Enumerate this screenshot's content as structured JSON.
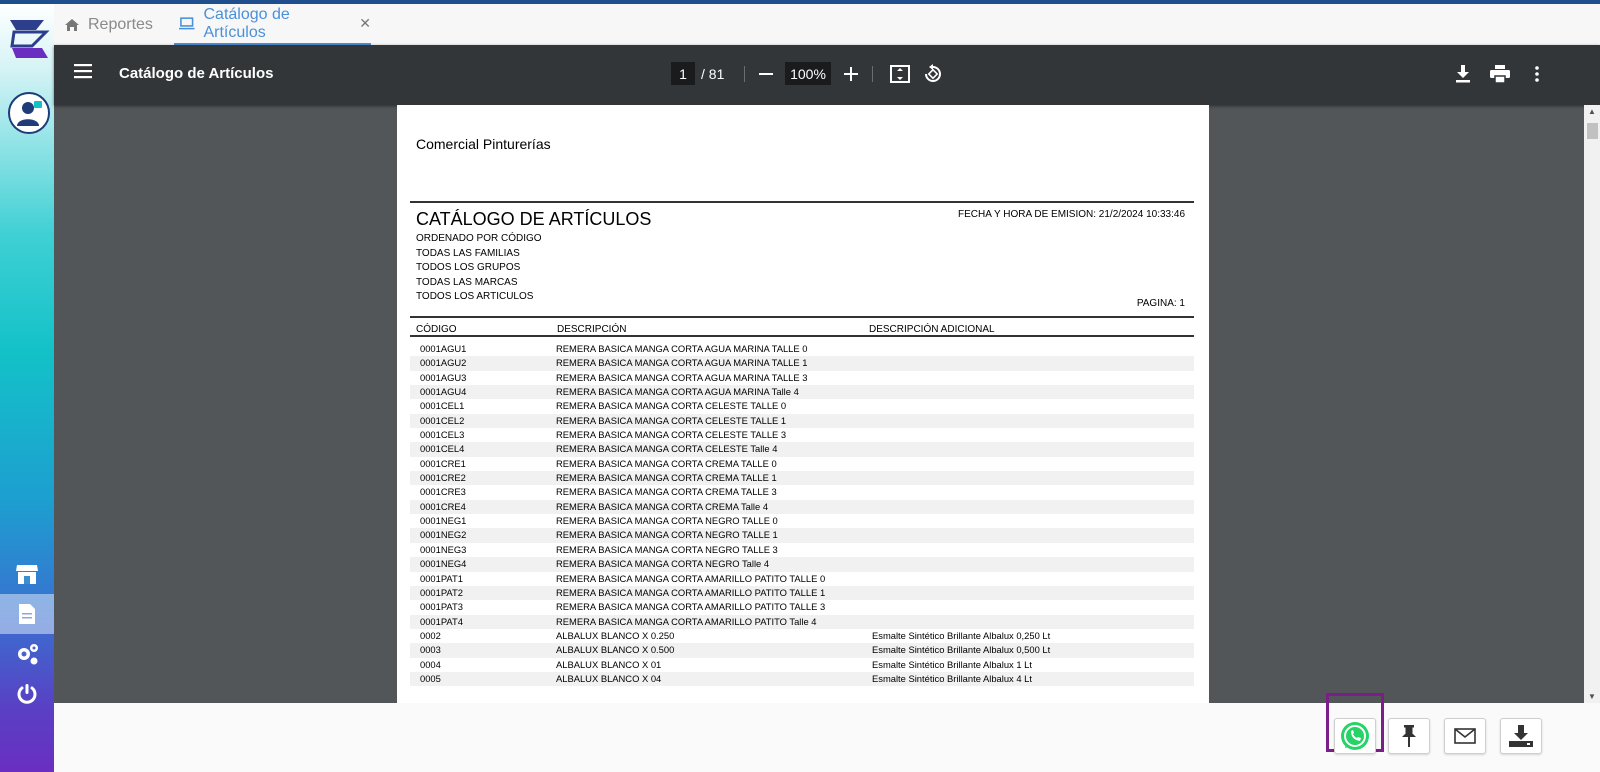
{
  "tabs": [
    {
      "label": "Reportes"
    },
    {
      "label": "Catálogo de Artículos"
    }
  ],
  "viewer": {
    "title": "Catálogo de Artículos",
    "current_page": "1",
    "page_total": "/ 81",
    "zoom": "100%"
  },
  "document": {
    "company": "Comercial Pinturerías",
    "title": "CATÁLOGO DE ARTÍCULOS",
    "emission": "FECHA Y HORA DE EMISION: 21/2/2024 10:33:46",
    "filters": [
      "ORDENADO POR CÓDIGO",
      "TODAS LAS FAMILIAS",
      "TODOS LOS GRUPOS",
      "TODAS LAS MARCAS",
      "TODOS LOS ARTICULOS"
    ],
    "pagina": "PAGINA: 1",
    "columns": {
      "code": "CÓDIGO",
      "desc": "DESCRIPCIÓN",
      "extra": "DESCRIPCIÓN ADICIONAL"
    },
    "rows": [
      [
        "0001AGU1",
        "REMERA BASICA MANGA CORTA AGUA MARINA TALLE 0",
        ""
      ],
      [
        "0001AGU2",
        "REMERA BASICA MANGA CORTA AGUA MARINA TALLE 1",
        ""
      ],
      [
        "0001AGU3",
        "REMERA BASICA MANGA CORTA AGUA MARINA TALLE 3",
        ""
      ],
      [
        "0001AGU4",
        "REMERA BASICA MANGA CORTA AGUA MARINA Talle 4",
        ""
      ],
      [
        "0001CEL1",
        "REMERA BASICA MANGA CORTA CELESTE TALLE 0",
        ""
      ],
      [
        "0001CEL2",
        "REMERA BASICA MANGA CORTA CELESTE TALLE 1",
        ""
      ],
      [
        "0001CEL3",
        "REMERA BASICA MANGA CORTA CELESTE TALLE 3",
        ""
      ],
      [
        "0001CEL4",
        "REMERA BASICA MANGA CORTA CELESTE Talle 4",
        ""
      ],
      [
        "0001CRE1",
        "REMERA BASICA MANGA CORTA CREMA TALLE 0",
        ""
      ],
      [
        "0001CRE2",
        "REMERA BASICA MANGA CORTA CREMA TALLE 1",
        ""
      ],
      [
        "0001CRE3",
        "REMERA BASICA MANGA CORTA CREMA TALLE 3",
        ""
      ],
      [
        "0001CRE4",
        "REMERA BASICA MANGA CORTA CREMA Talle 4",
        ""
      ],
      [
        "0001NEG1",
        "REMERA BASICA MANGA CORTA NEGRO TALLE 0",
        ""
      ],
      [
        "0001NEG2",
        "REMERA BASICA MANGA CORTA NEGRO TALLE 1",
        ""
      ],
      [
        "0001NEG3",
        "REMERA BASICA MANGA CORTA NEGRO TALLE 3",
        ""
      ],
      [
        "0001NEG4",
        "REMERA BASICA MANGA CORTA NEGRO Talle 4",
        ""
      ],
      [
        "0001PAT1",
        "REMERA BASICA MANGA CORTA AMARILLO PATITO TALLE 0",
        ""
      ],
      [
        "0001PAT2",
        "REMERA BASICA MANGA CORTA AMARILLO PATITO TALLE 1",
        ""
      ],
      [
        "0001PAT3",
        "REMERA BASICA MANGA CORTA AMARILLO PATITO TALLE 3",
        ""
      ],
      [
        "0001PAT4",
        "REMERA BASICA MANGA CORTA AMARILLO PATITO Talle 4",
        ""
      ],
      [
        "0002",
        "ALBALUX BLANCO X 0.250",
        "Esmalte Sintético Brillante Albalux 0,250 Lt"
      ],
      [
        "0003",
        "ALBALUX BLANCO X 0.500",
        "Esmalte Sintético Brillante Albalux 0,500 Lt"
      ],
      [
        "0004",
        "ALBALUX BLANCO X 01",
        "Esmalte Sintético Brillante Albalux 1 Lt"
      ],
      [
        "0005",
        "ALBALUX BLANCO X 04",
        "Esmalte Sintético Brillante Albalux 4 Lt"
      ]
    ]
  },
  "colors": {
    "accent": "#4a90d9",
    "toolbar": "#323639",
    "viewer_bg": "#525659",
    "whatsapp": "#25d366",
    "highlight": "#7b1e8a"
  }
}
